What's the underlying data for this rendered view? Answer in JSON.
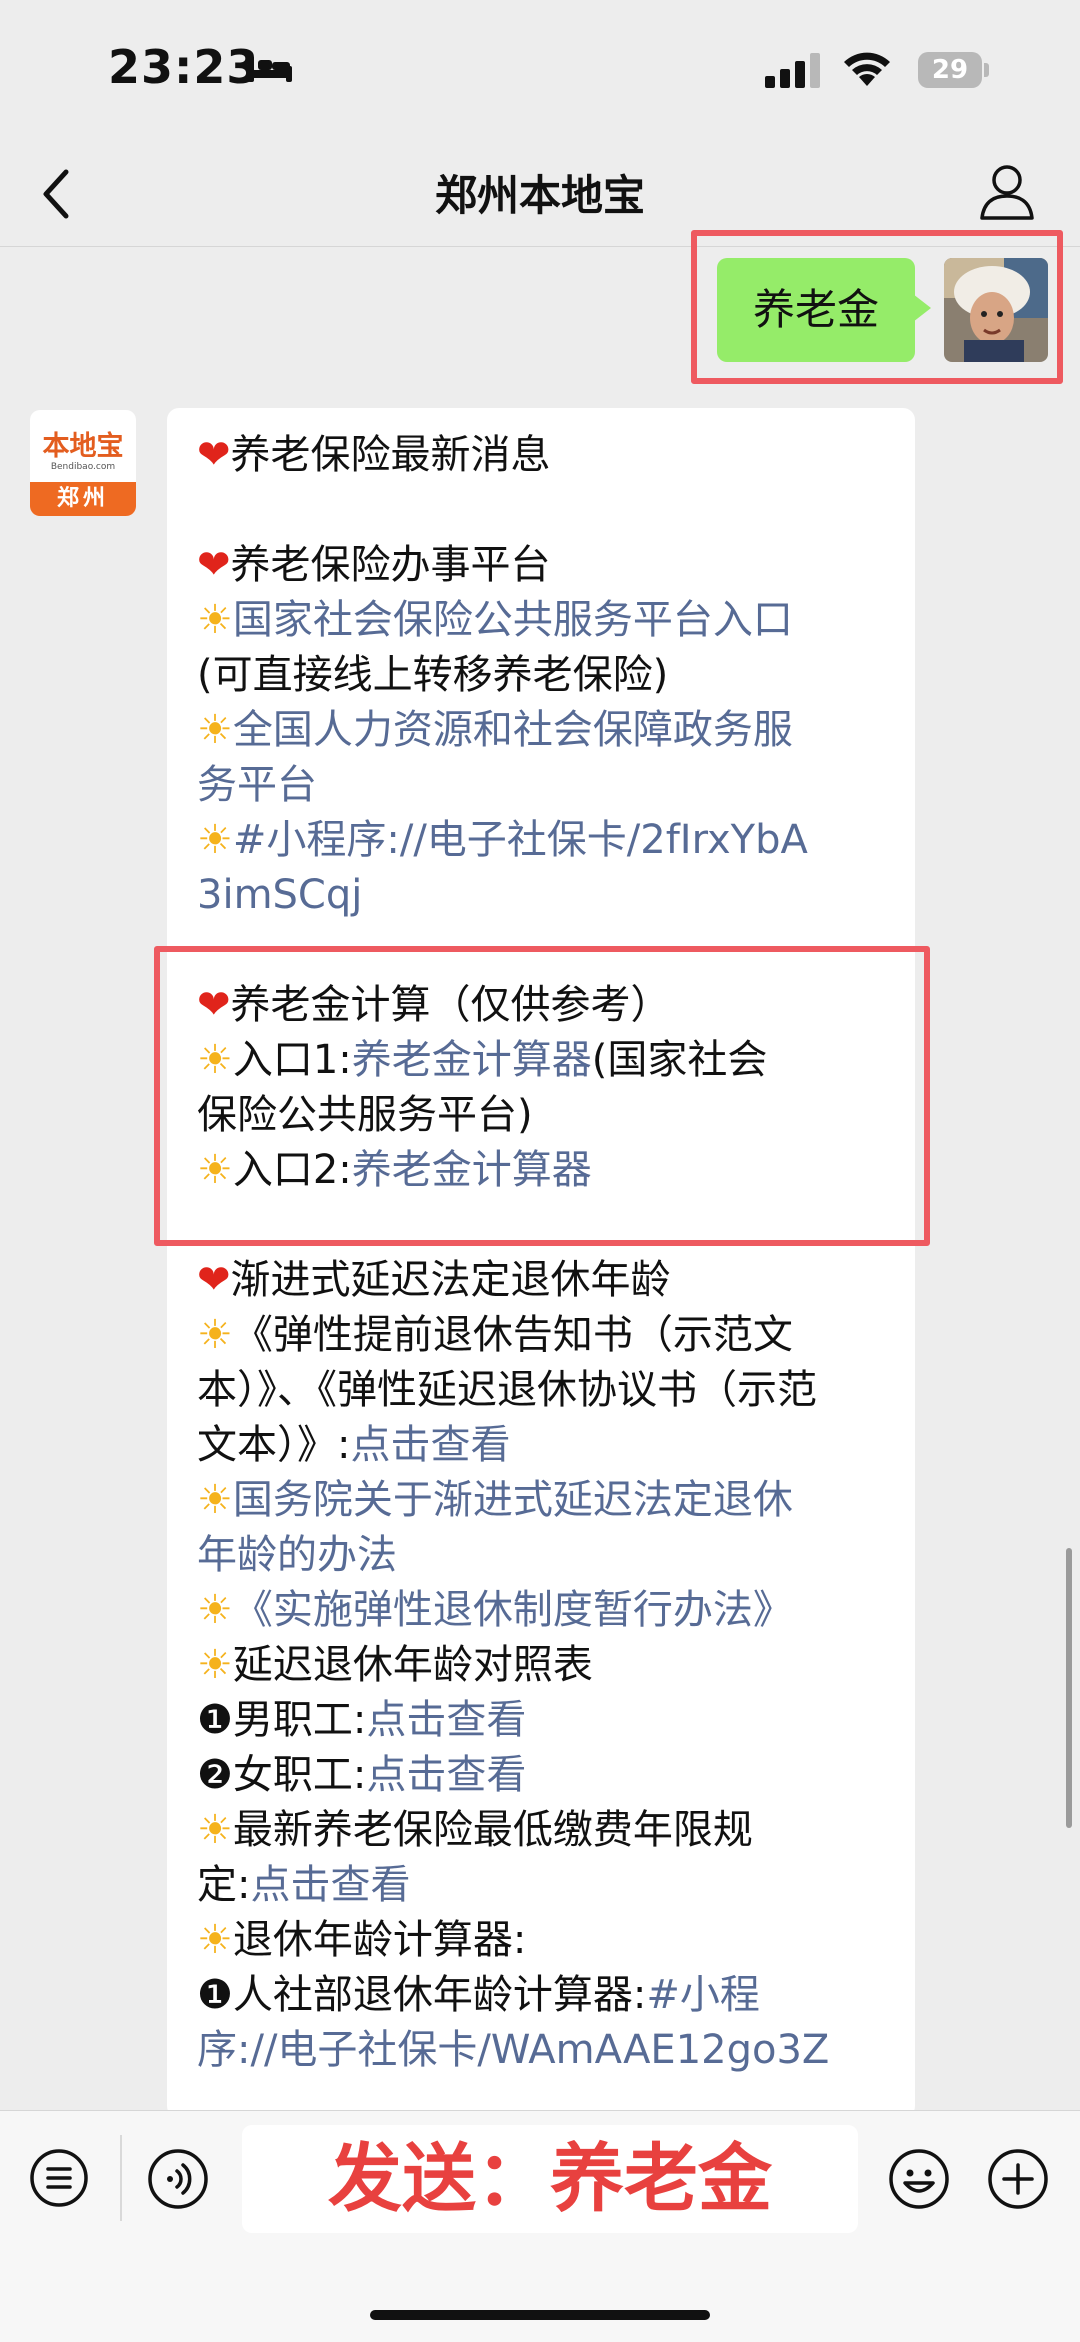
{
  "status_bar": {
    "time": "23:23",
    "battery": "29"
  },
  "nav": {
    "title": "郑州本地宝"
  },
  "sent_message": {
    "text": "养老金"
  },
  "bot": {
    "logo_text": "本地宝",
    "logo_url": "Bendibao.com",
    "logo_city": "郑州"
  },
  "reply": {
    "l1": "养老保险最新消息",
    "l3": "养老保险办事平台",
    "l4": "国家社会保险公共服务平台入口",
    "l5": "(可直接线上转移养老保险)",
    "l6": "全国人力资源和社会保障政务服",
    "l7": "务平台",
    "l8": "#小程序://电子社保卡/2fIrxYbA",
    "l9": "3imSCqj",
    "l11": "养老金计算（仅供参考）",
    "l12a": "入口1:",
    "l12b": "养老金计算器",
    "l12c": "(国家社会",
    "l13": "保险公共服务平台)",
    "l14a": "入口2:",
    "l14b": "养老金计算器",
    "l16": "渐进式延迟法定退休年龄",
    "l17": "《弹性提前退休告知书（示范文",
    "l18": "本）》、《弹性延迟退休协议书（示范",
    "l19a": "文本）》:",
    "l19b": "点击查看",
    "l20": "国务院关于渐进式延迟法定退休",
    "l21": "年龄的办法",
    "l22": "《实施弹性退休制度暂行办法》",
    "l23": "延迟退休年龄对照表",
    "l24a": "❶男职工:",
    "l24b": "点击查看",
    "l25a": "❷女职工:",
    "l25b": "点击查看",
    "l26": "最新养老保险最低缴费年限规",
    "l27a": "定:",
    "l27b": "点击查看",
    "l28": "退休年龄计算器:",
    "l29a": "❶人社部退休年龄计算器:",
    "l29b": "#小程",
    "l30": "序://电子社保卡/WAmAAE12go3Z"
  },
  "input": {
    "text": "发送：养老金"
  },
  "icons": {
    "heart": "heart-icon",
    "sun": "sun-icon"
  },
  "colors": {
    "link": "#576b95",
    "sent_bubble": "#95ec69",
    "highlight": "#ee5a60",
    "input_text": "#e8413f"
  }
}
